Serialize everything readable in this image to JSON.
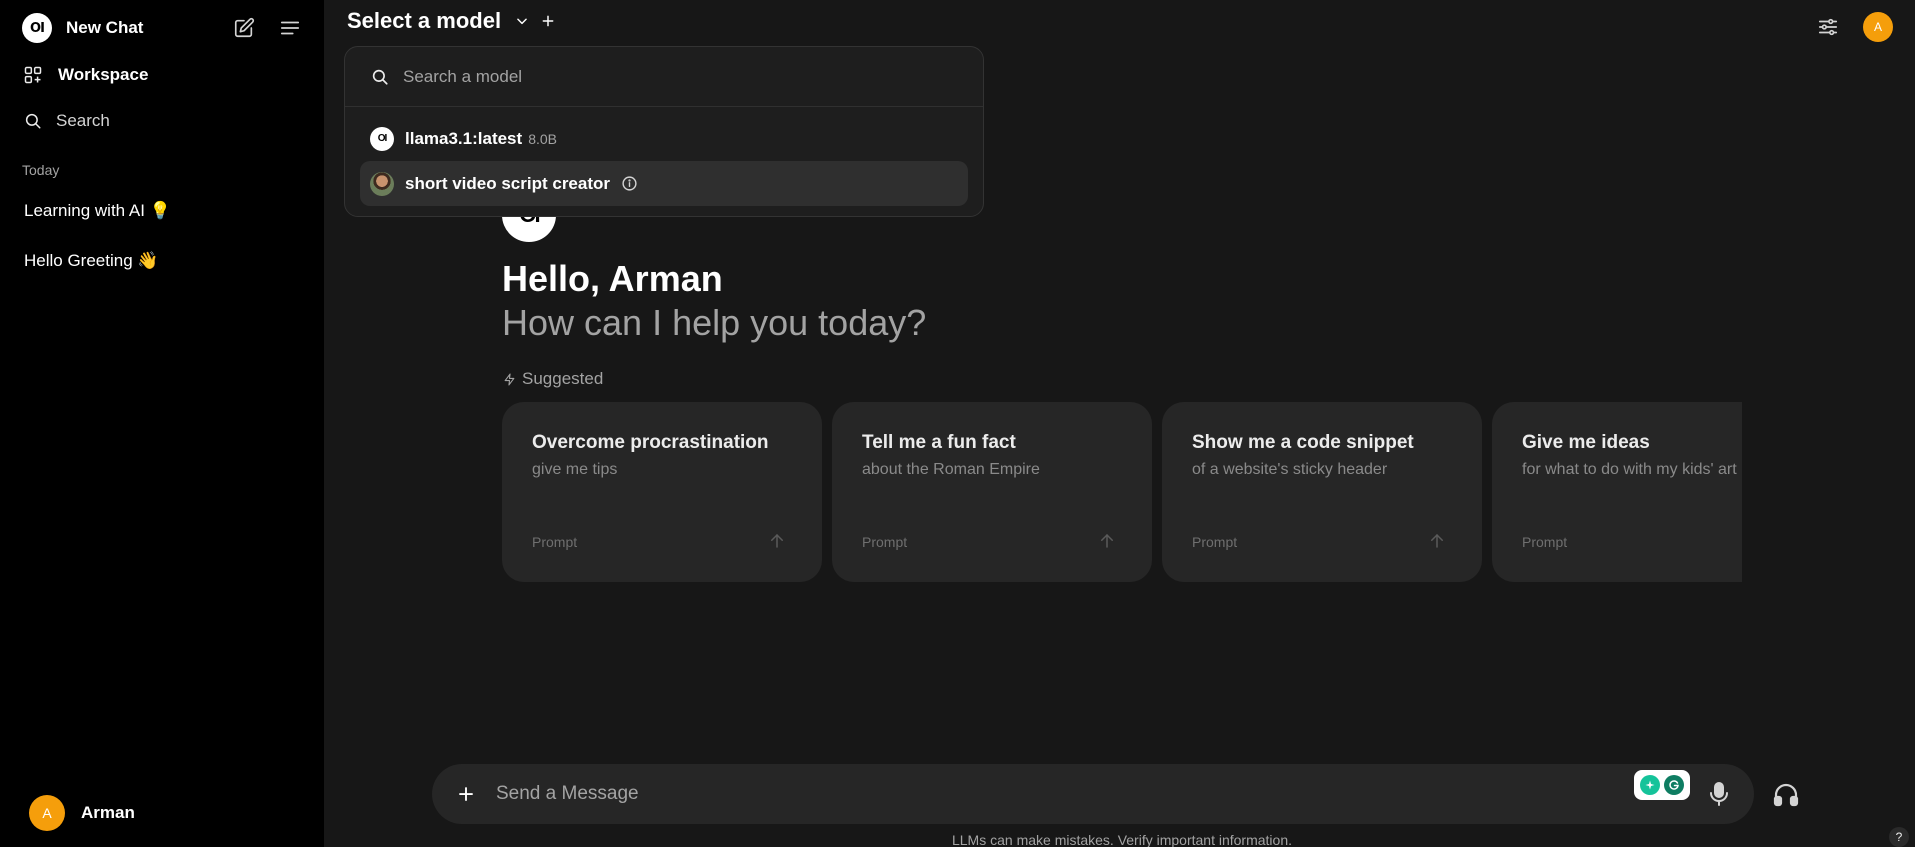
{
  "sidebar": {
    "logo_text": "OI",
    "new_chat_label": "New Chat",
    "workspace_label": "Workspace",
    "search_label": "Search",
    "section_today": "Today",
    "chats": [
      {
        "label": "Learning with AI 💡"
      },
      {
        "label": "Hello Greeting 👋"
      }
    ],
    "user": {
      "initial": "A",
      "name": "Arman"
    }
  },
  "header": {
    "model_title": "Select a model",
    "user_initial": "A"
  },
  "model_dropdown": {
    "search_placeholder": "Search a model",
    "items": [
      {
        "name": "llama3.1:latest",
        "size": "8.0B",
        "logo_text": "OI"
      },
      {
        "name": "short video script creator"
      }
    ]
  },
  "main": {
    "logo_text": "OI",
    "greeting": "Hello, Arman",
    "subtitle": "How can I help you today?",
    "suggested_label": "Suggested",
    "cards": [
      {
        "title": "Overcome procrastination",
        "subtitle": "give me tips",
        "prompt": "Prompt"
      },
      {
        "title": "Tell me a fun fact",
        "subtitle": "about the Roman Empire",
        "prompt": "Prompt"
      },
      {
        "title": "Show me a code snippet",
        "subtitle": "of a website's sticky header",
        "prompt": "Prompt"
      },
      {
        "title": "Give me ideas",
        "subtitle": "for what to do with my kids' art",
        "prompt": "Prompt"
      }
    ]
  },
  "composer": {
    "placeholder": "Send a Message",
    "disclaimer": "LLMs can make mistakes. Verify important information.",
    "help_label": "?"
  },
  "colors": {
    "background": "#171717",
    "sidebar": "#000000",
    "card": "#262626",
    "avatar": "#f59e0b",
    "grammarly": "#15c39a"
  }
}
